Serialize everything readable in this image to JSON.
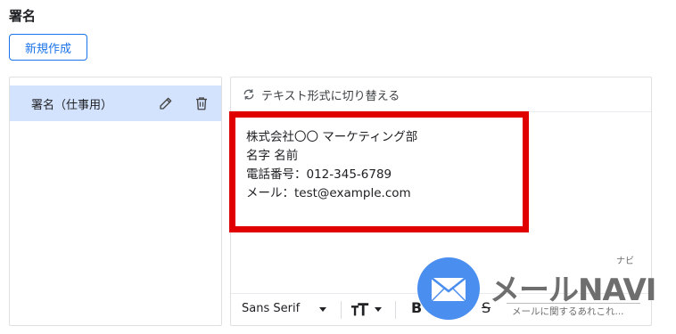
{
  "section": {
    "title": "署名",
    "new_button": "新規作成"
  },
  "signature_list": {
    "items": [
      {
        "label": "署名（仕事用）",
        "selected": true
      }
    ]
  },
  "editor": {
    "switch_label": "テキスト形式に切り替える",
    "body_lines": [
      "株式会社〇〇 マーケティング部",
      "名字 名前",
      "電話番号：012-345-6789",
      "メール：test@example.com"
    ],
    "toolbar": {
      "font": "Sans Serif",
      "bold_glyph": "B",
      "strike_glyph": "S"
    }
  },
  "watermark": {
    "brand": "メールNAVI",
    "ruby": "ナビ",
    "tagline": "メールに関するあれこれ..."
  },
  "colors": {
    "accent": "#1a73e8",
    "selected_bg": "#d3e3fd",
    "highlight": "#e00000",
    "watermark_blue": "#4a8ef0"
  },
  "icons": [
    "edit-icon",
    "delete-icon",
    "refresh-icon",
    "font-size-icon",
    "bold-icon",
    "strikethrough-icon",
    "mail-icon"
  ]
}
